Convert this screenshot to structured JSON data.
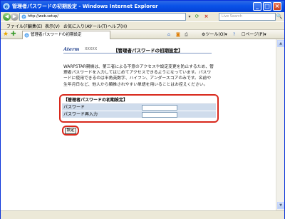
{
  "window": {
    "title": "管理者パスワードの初期設定 - Windows Internet Explorer"
  },
  "address": {
    "url": "http://web.setup/"
  },
  "search": {
    "placeholder": "Live Search"
  },
  "menu": {
    "items": [
      "ファイル(F)",
      "編集(E)",
      "表示(V)",
      "お気に入り(A)",
      "ツール(T)",
      "ヘルプ(H)"
    ]
  },
  "tab": {
    "title": "管理者パスワードの初期設定"
  },
  "toolbar": {
    "tools_label": "ツール(O)",
    "page_label": "ページ(P)"
  },
  "page": {
    "brand": "Aterm",
    "brand_suffix": "XXXXX",
    "title": "【管理者パスワードの初期設定】",
    "description": "WARPSTAR親機は、第三者による不意のアクセスや設定変更を防止するため、管理者パスワードを入力してはじめてアクセスできるようになっています。パスワードに使用できるのは半角英数字、ハイフン、アンダースコアのみです。名前や生年月日など、他人から類推されやすい単語を用いることはお控えください。",
    "form": {
      "title": "【管理者パスワードの初期設定】",
      "password_label": "パスワード",
      "password_confirm_label": "パスワード再入力"
    },
    "set_button": "設定"
  },
  "colors": {
    "titlebar": "#0a52e8",
    "highlight_ring": "#d8281c",
    "form_row": "#cfdcec",
    "brand": "#1b3b8a"
  }
}
